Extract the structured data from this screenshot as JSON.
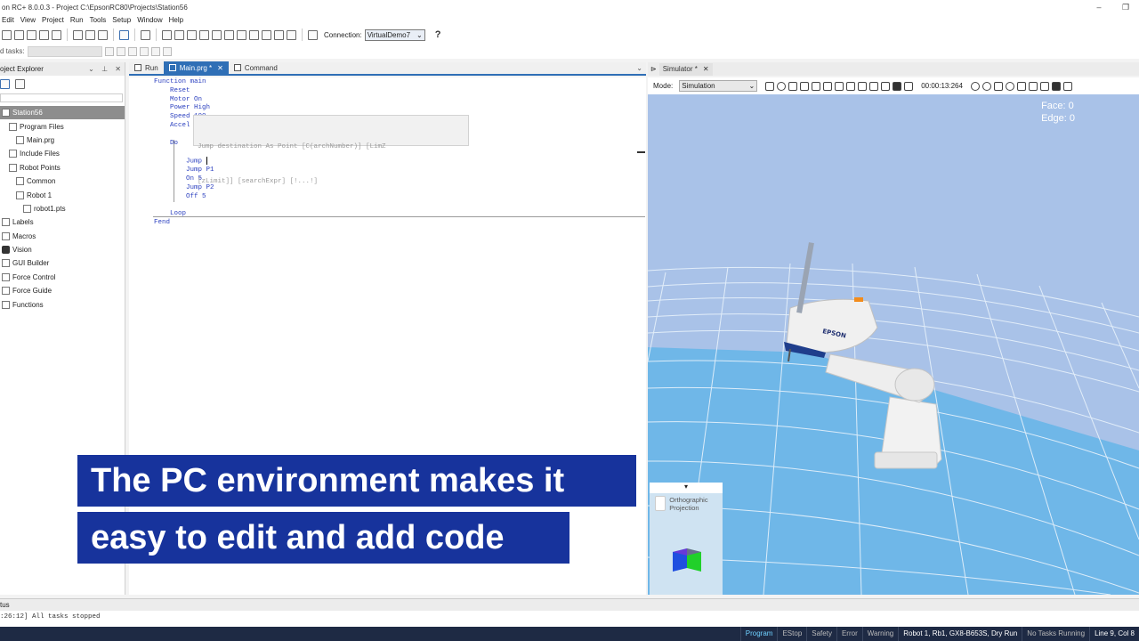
{
  "window": {
    "title": "on RC+ 8.0.0.3 - Project C:\\EpsonRC80\\Projects\\Station56",
    "minimize_glyph": "–",
    "restore_glyph": "❐"
  },
  "menu": [
    "Edit",
    "View",
    "Project",
    "Run",
    "Tools",
    "Setup",
    "Window",
    "Help"
  ],
  "toolbar": {
    "connection_label": "Connection:",
    "connection_value": "VirtualDemo7",
    "help_icon": "?",
    "tasks_label": "d tasks:"
  },
  "explorer": {
    "title": "oject Explorer",
    "items": [
      {
        "label": "Station56",
        "selected": true,
        "indent": 0,
        "icon": "project-icon"
      },
      {
        "label": "Program Files",
        "indent": 1,
        "icon": "folder-icon"
      },
      {
        "label": "Main.prg",
        "indent": 2,
        "icon": "file-icon"
      },
      {
        "label": "Include Files",
        "indent": 1,
        "icon": "file-icon"
      },
      {
        "label": "Robot Points",
        "indent": 1,
        "icon": "robot-icon"
      },
      {
        "label": "Common",
        "indent": 2,
        "icon": "robot-icon"
      },
      {
        "label": "Robot 1",
        "indent": 2,
        "icon": "robot-icon"
      },
      {
        "label": "robot1.pts",
        "indent": 3,
        "icon": "points-file-icon"
      },
      {
        "label": "Labels",
        "indent": 0,
        "icon": "labels-icon"
      },
      {
        "label": "Macros",
        "indent": 0,
        "icon": "macros-icon"
      },
      {
        "label": "Vision",
        "indent": 0,
        "icon": "camera-icon"
      },
      {
        "label": "GUI Builder",
        "indent": 0,
        "icon": "gui-icon"
      },
      {
        "label": "Force Control",
        "indent": 0,
        "icon": "force-icon"
      },
      {
        "label": "Force Guide",
        "indent": 0,
        "icon": "force-icon"
      },
      {
        "label": "Functions",
        "indent": 0,
        "icon": "functions-icon"
      }
    ]
  },
  "tabs": [
    {
      "label": "Run",
      "active": false,
      "closable": false
    },
    {
      "label": "Main.prg *",
      "active": true,
      "closable": true
    },
    {
      "label": "Command",
      "active": false,
      "closable": false
    }
  ],
  "editor": {
    "code": "Function main\n    Reset\n    Motor On\n    Power High\n    Speed 100\n    Accel 100\n\n    Do\n\n        Jump \n        Jump P1\n        On 5\n        Jump P2\n        Off 5\n\n    Loop\nFend",
    "tooltip_line1": "Jump destination As Point [C(archNumber)] [LimZ",
    "tooltip_line2": "[zLimit]] [searchExpr] [!...!]"
  },
  "simulator": {
    "tab_label": "Simulator *",
    "mode_label": "Mode:",
    "mode_value": "Simulation",
    "time": "00:00:13:264",
    "face_label": "Face: 0",
    "edge_label": "Edge: 0",
    "robot_brand": "EPSON",
    "orthographic_label": "Orthographic Projection",
    "orth_toggle": "▾",
    "colors": {
      "sky": "#a9c2e8",
      "floor": "#6fb7e8",
      "grid": "#e8f2fb"
    }
  },
  "status": {
    "panel_title": "tus",
    "log": ":26:12] All tasks stopped"
  },
  "statusbar": {
    "items": [
      {
        "label": "Program",
        "state": "active"
      },
      {
        "label": "EStop",
        "state": "off"
      },
      {
        "label": "Safety",
        "state": "off"
      },
      {
        "label": "Error",
        "state": "off"
      },
      {
        "label": "Warning",
        "state": "off"
      },
      {
        "label": "Robot 1, Rb1, GX8-B653S, Dry Run",
        "state": "on"
      },
      {
        "label": "No Tasks Running",
        "state": "off"
      },
      {
        "label": "Line 9, Col 8",
        "state": "on"
      }
    ]
  },
  "caption": {
    "line1": "The PC environment makes it",
    "line2": "easy to edit and add code"
  }
}
